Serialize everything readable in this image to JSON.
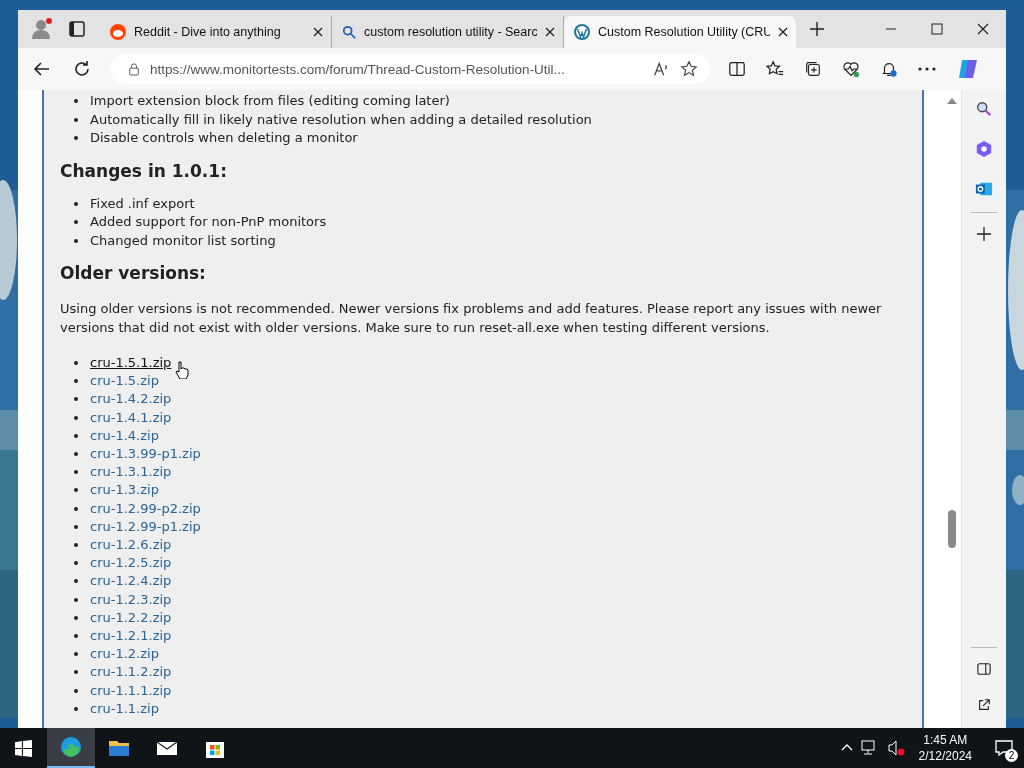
{
  "browser": {
    "tabs": [
      {
        "title": "Reddit - Dive into anything",
        "selected": false
      },
      {
        "title": "custom resolution utility - Searc",
        "selected": false
      },
      {
        "title": "Custom Resolution Utility (CRU",
        "selected": true
      }
    ],
    "url": "https://www.monitortests.com/forum/Thread-Custom-Resolution-Util..."
  },
  "page": {
    "items_top": [
      "Import extension block from files (editing coming later)",
      "Automatically fill in likely native resolution when adding a detailed resolution",
      "Disable controls when deleting a monitor"
    ],
    "sections": [
      {
        "heading": "Changes in 1.0.1:",
        "items": [
          "Fixed .inf export",
          "Added support for non-PnP monitors",
          "Changed monitor list sorting"
        ]
      }
    ],
    "older_heading": "Older versions:",
    "older_text": "Using older versions is not recommended. Newer versions fix problems and add features. Please report any issues with newer versions that did not exist with older versions. Make sure to run reset-all.exe when testing different versions.",
    "downloads": [
      {
        "label": "cru-1.5.1.zip",
        "hovered": true
      },
      {
        "label": "cru-1.5.zip",
        "hovered": false
      },
      {
        "label": "cru-1.4.2.zip",
        "hovered": false
      },
      {
        "label": "cru-1.4.1.zip",
        "hovered": false
      },
      {
        "label": "cru-1.4.zip",
        "hovered": false
      },
      {
        "label": "cru-1.3.99-p1.zip",
        "hovered": false
      },
      {
        "label": "cru-1.3.1.zip",
        "hovered": false
      },
      {
        "label": "cru-1.3.zip",
        "hovered": false
      },
      {
        "label": "cru-1.2.99-p2.zip",
        "hovered": false
      },
      {
        "label": "cru-1.2.99-p1.zip",
        "hovered": false
      },
      {
        "label": "cru-1.2.6.zip",
        "hovered": false
      },
      {
        "label": "cru-1.2.5.zip",
        "hovered": false
      },
      {
        "label": "cru-1.2.4.zip",
        "hovered": false
      },
      {
        "label": "cru-1.2.3.zip",
        "hovered": false
      },
      {
        "label": "cru-1.2.2.zip",
        "hovered": false
      },
      {
        "label": "cru-1.2.1.zip",
        "hovered": false
      },
      {
        "label": "cru-1.2.zip",
        "hovered": false
      },
      {
        "label": "cru-1.1.2.zip",
        "hovered": false
      },
      {
        "label": "cru-1.1.1.zip",
        "hovered": false
      },
      {
        "label": "cru-1.1.zip",
        "hovered": false
      }
    ]
  },
  "taskbar": {
    "time": "1:45 AM",
    "date": "2/12/2024",
    "notifications": "2"
  }
}
